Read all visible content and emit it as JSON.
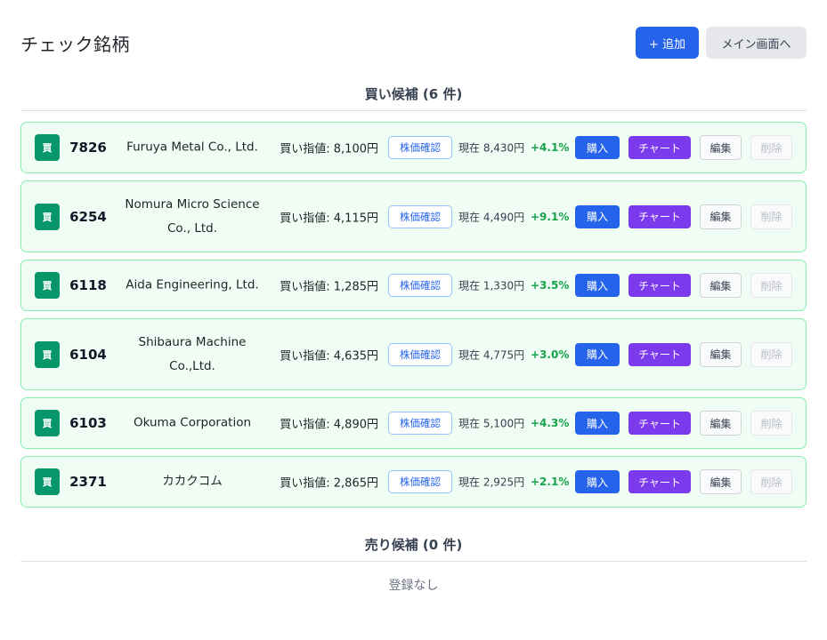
{
  "header": {
    "title": "チェック銘柄",
    "add_label": "+ 追加",
    "main_label": "メイン画面へ"
  },
  "buy_section": {
    "heading": "買い候補 (6 件)"
  },
  "sell_section": {
    "heading": "売り候補 (0 件)",
    "empty_text": "登録なし"
  },
  "rows": [
    {
      "badge": "買",
      "code": "7826",
      "name": "Furuya Metal Co., Ltd.",
      "target": "買い指値: 8,100円",
      "price_check": "株価確認",
      "current": "現在 8,430円",
      "change": "+4.1%",
      "buy": "購入",
      "chart": "チャート",
      "edit": "編集",
      "delete": "削除"
    },
    {
      "badge": "買",
      "code": "6254",
      "name": "Nomura Micro Science Co., Ltd.",
      "target": "買い指値: 4,115円",
      "price_check": "株価確認",
      "current": "現在 4,490円",
      "change": "+9.1%",
      "buy": "購入",
      "chart": "チャート",
      "edit": "編集",
      "delete": "削除"
    },
    {
      "badge": "買",
      "code": "6118",
      "name": "Aida Engineering, Ltd.",
      "target": "買い指値: 1,285円",
      "price_check": "株価確認",
      "current": "現在 1,330円",
      "change": "+3.5%",
      "buy": "購入",
      "chart": "チャート",
      "edit": "編集",
      "delete": "削除"
    },
    {
      "badge": "買",
      "code": "6104",
      "name": "Shibaura Machine Co.,Ltd.",
      "target": "買い指値: 4,635円",
      "price_check": "株価確認",
      "current": "現在 4,775円",
      "change": "+3.0%",
      "buy": "購入",
      "chart": "チャート",
      "edit": "編集",
      "delete": "削除"
    },
    {
      "badge": "買",
      "code": "6103",
      "name": "Okuma Corporation",
      "target": "買い指値: 4,890円",
      "price_check": "株価確認",
      "current": "現在 5,100円",
      "change": "+4.3%",
      "buy": "購入",
      "chart": "チャート",
      "edit": "編集",
      "delete": "削除"
    },
    {
      "badge": "買",
      "code": "2371",
      "name": "カカクコム",
      "target": "買い指値: 2,865円",
      "price_check": "株価確認",
      "current": "現在 2,925円",
      "change": "+2.1%",
      "buy": "購入",
      "chart": "チャート",
      "edit": "編集",
      "delete": "削除"
    }
  ]
}
